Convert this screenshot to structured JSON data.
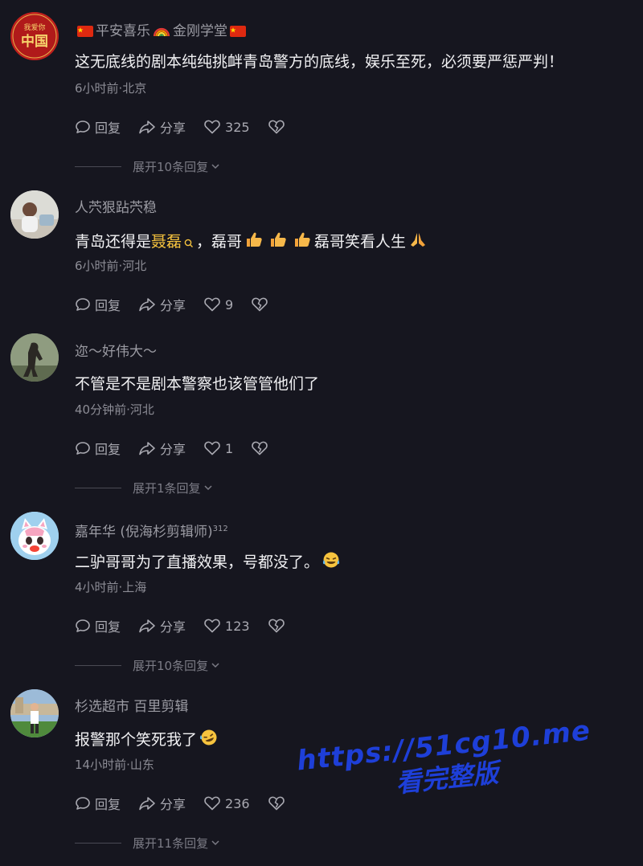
{
  "actions": {
    "reply": "回复",
    "share": "分享"
  },
  "comments": [
    {
      "name_parts": [
        "平安喜乐",
        "金刚学堂"
      ],
      "avatar_text": "中国",
      "avatar_small": "我爱你",
      "text": "这无底线的剧本纯纯挑衅青岛警方的底线，娱乐至死，必须要严惩严判！",
      "meta": "6小时前·北京",
      "likes": "325",
      "expand": "展开10条回复"
    },
    {
      "name": "人茓狠跕茓稳",
      "text_parts": [
        "青岛还得是",
        "聂磊",
        "，磊哥",
        "磊哥笑看人生"
      ],
      "meta": "6小时前·河北",
      "likes": "9"
    },
    {
      "name": "迩～好伟大～",
      "text": "不管是不是剧本警察也该管管他们了",
      "meta": "40分钟前·河北",
      "likes": "1",
      "expand": "展开1条回复"
    },
    {
      "name": "嘉年华 (倪海杉剪辑师)",
      "name_sup": "312",
      "text": "二驴哥哥为了直播效果，号都没了。",
      "meta": "4小时前·上海",
      "likes": "123",
      "expand": "展开10条回复"
    },
    {
      "name": "杉选超市 百里剪辑",
      "text": "报警那个笑死我了",
      "meta": "14小时前·山东",
      "likes": "236",
      "expand": "展开11条回复"
    }
  ],
  "watermark": {
    "url": "https://51cg10.me",
    "label": "看完整版"
  },
  "colors": {
    "background": "#16161f",
    "highlight": "#f6c33e",
    "watermark": "#1e3fd8"
  }
}
